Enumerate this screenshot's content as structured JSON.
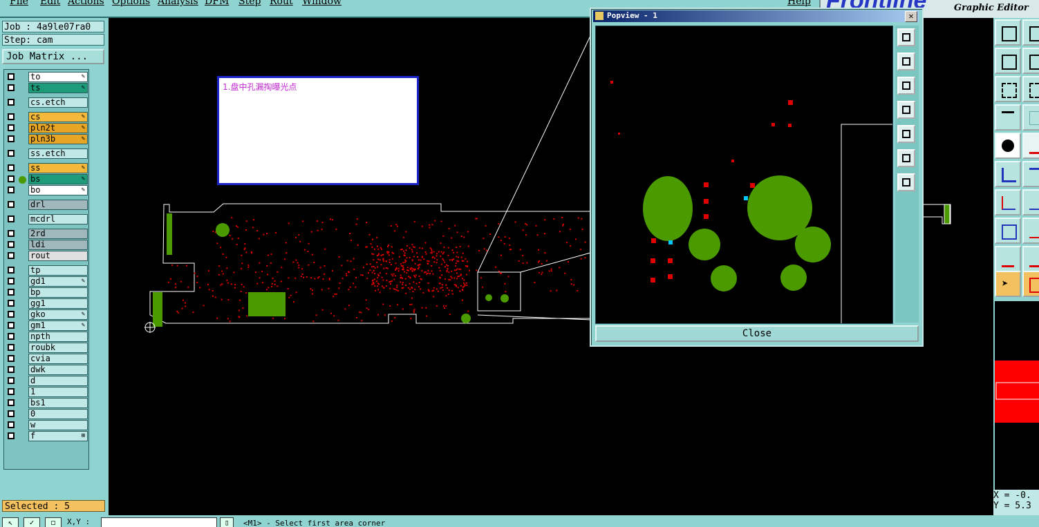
{
  "menubar": {
    "items": [
      "File",
      "Edit",
      "Actions",
      "Options",
      "Analysis",
      "DFM",
      "Step",
      "Rout",
      "Window"
    ],
    "help": "Help"
  },
  "brand": {
    "logo": "Frontline",
    "title": "Graphic Editor"
  },
  "job": {
    "job_label": "Job : 4a9le07ra0",
    "step_label": "Step: cam",
    "matrix_button": "Job Matrix ..."
  },
  "layers": [
    {
      "name": "to",
      "color": "#ffffff",
      "mark": "✎"
    },
    {
      "name": "ts",
      "color": "#1e9c7a",
      "mark": "✎"
    },
    {
      "name": "cs.etch",
      "color": "#bfe8e6",
      "mark": ""
    },
    {
      "name": "cs",
      "color": "#f4b93a",
      "mark": "✎"
    },
    {
      "name": "pln2t",
      "color": "#e6a524",
      "mark": "✎"
    },
    {
      "name": "pln3b",
      "color": "#e6a524",
      "mark": "✎"
    },
    {
      "name": "ss.etch",
      "color": "#bfe8e6",
      "mark": ""
    },
    {
      "name": "ss",
      "color": "#f4b93a",
      "mark": "✎"
    },
    {
      "name": "bs",
      "color": "#1e9c7a",
      "mark": "✎"
    },
    {
      "name": "bo",
      "color": "#ffffff",
      "mark": "✎"
    },
    {
      "name": "drl",
      "color": "#a0b8bc",
      "mark": ""
    },
    {
      "name": "mcdrl",
      "color": "#bfe8e6",
      "mark": ""
    },
    {
      "name": "2rd",
      "color": "#a0b8bc",
      "mark": ""
    },
    {
      "name": "ldi",
      "color": "#a0b8bc",
      "mark": ""
    },
    {
      "name": "rout",
      "color": "#e0e0e0",
      "mark": ""
    },
    {
      "name": "tp",
      "color": "#bfe8e6",
      "mark": ""
    },
    {
      "name": "gd1",
      "color": "#bfe8e6",
      "mark": "✎"
    },
    {
      "name": "bp",
      "color": "#bfe8e6",
      "mark": ""
    },
    {
      "name": "gg1",
      "color": "#bfe8e6",
      "mark": ""
    },
    {
      "name": "gko",
      "color": "#bfe8e6",
      "mark": "✎"
    },
    {
      "name": "gm1",
      "color": "#bfe8e6",
      "mark": "✎"
    },
    {
      "name": "npth",
      "color": "#bfe8e6",
      "mark": ""
    },
    {
      "name": "roubk",
      "color": "#bfe8e6",
      "mark": ""
    },
    {
      "name": "cvia",
      "color": "#bfe8e6",
      "mark": ""
    },
    {
      "name": "dwk",
      "color": "#bfe8e6",
      "mark": ""
    },
    {
      "name": "d",
      "color": "#bfe8e6",
      "mark": ""
    },
    {
      "name": "1",
      "color": "#bfe8e6",
      "mark": ""
    },
    {
      "name": "bs1",
      "color": "#bfe8e6",
      "mark": ""
    },
    {
      "name": "0",
      "color": "#bfe8e6",
      "mark": ""
    },
    {
      "name": "w",
      "color": "#bfe8e6",
      "mark": ""
    },
    {
      "name": "f",
      "color": "#bfe8e6",
      "mark": "⊞"
    }
  ],
  "selected": "Selected : 5",
  "note": {
    "text": "1.盘中孔漏掏曝光点"
  },
  "popview": {
    "title": "Popview - 1",
    "close_button": "Close",
    "close_x": "✕"
  },
  "bottombar": {
    "xy_label": "X,Y :",
    "xy_value": "",
    "hint": "<M1> - Select first area corner"
  },
  "coords": {
    "x": "X = -0.",
    "y": "Y = 5.3"
  },
  "colors": {
    "panel": "#8fd4d0",
    "pad_red": "#ff0000",
    "pad_green": "#4a9a00",
    "highlight": "#00c8ff"
  }
}
